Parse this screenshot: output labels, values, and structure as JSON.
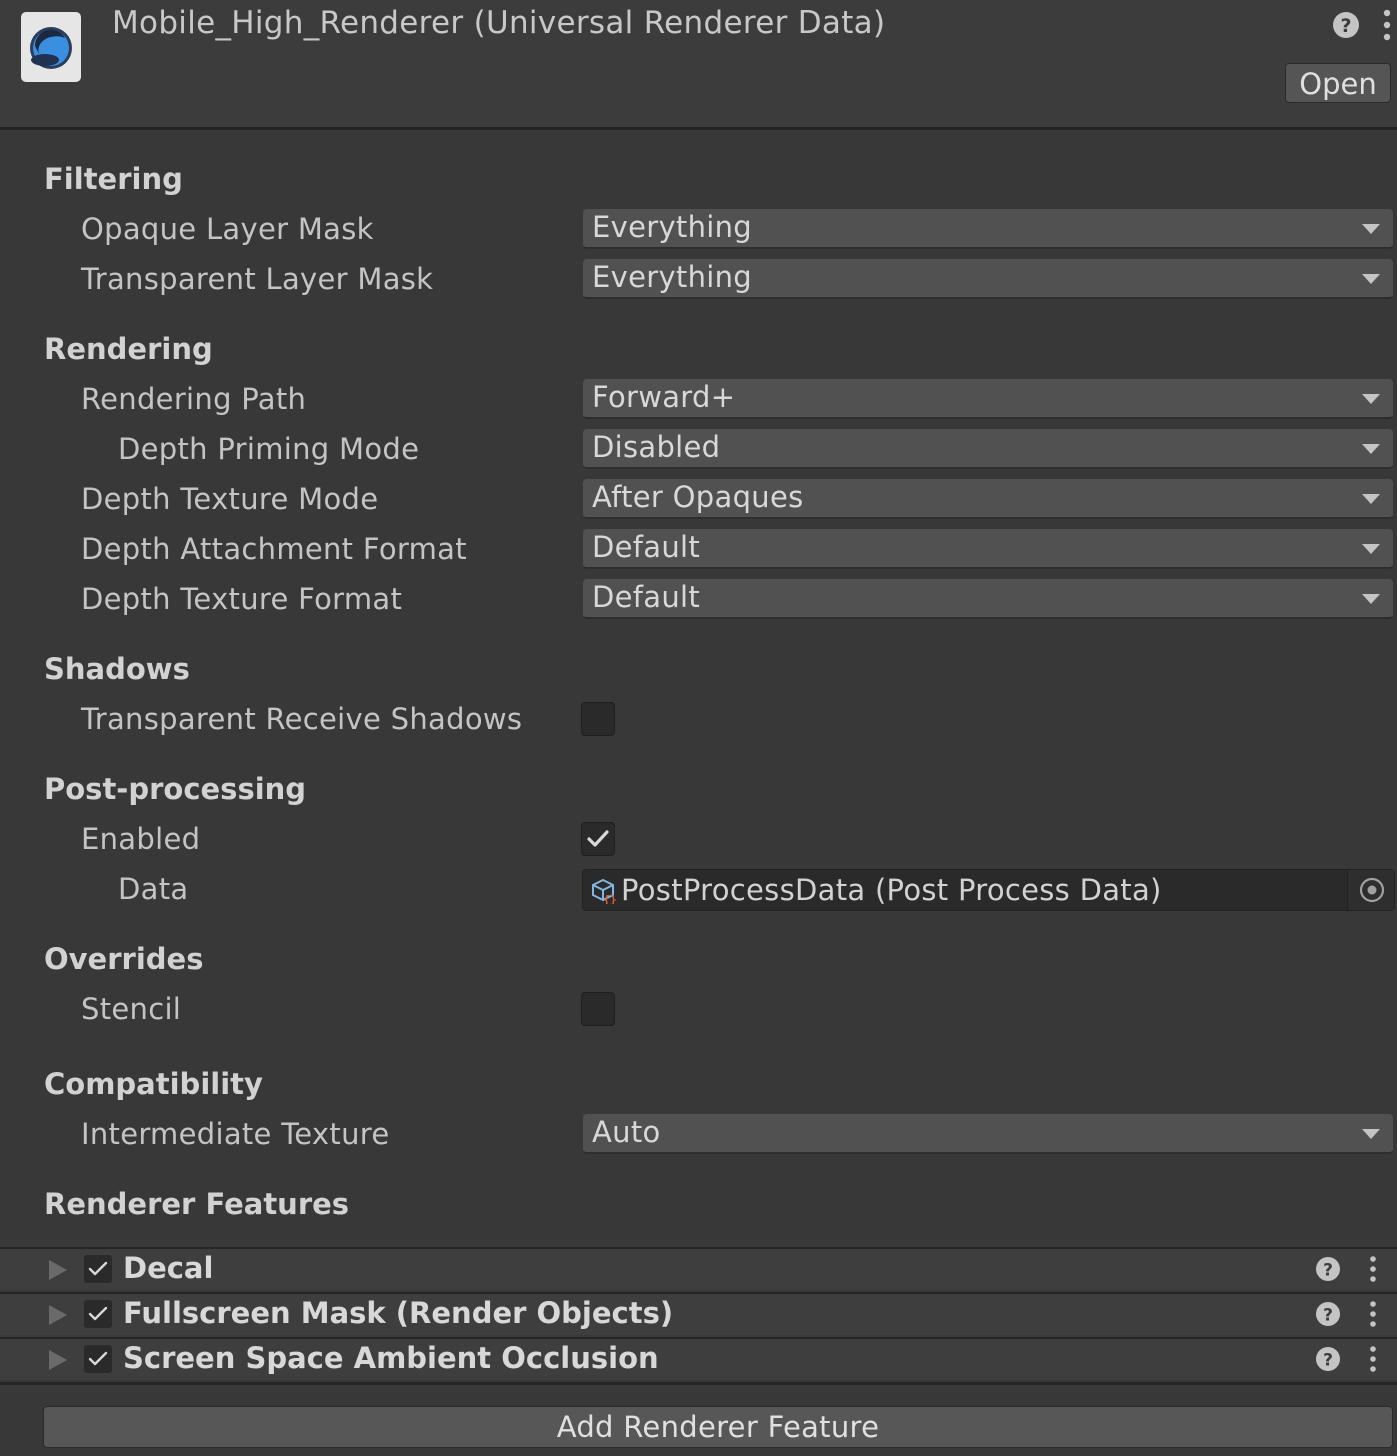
{
  "header": {
    "title": "Mobile_High_Renderer (Universal Renderer Data)",
    "asset_icon": "universal-renderer-data-icon",
    "help_icon": "help-icon",
    "menu_icon": "kebab-menu-icon",
    "open_label": "Open"
  },
  "filtering": {
    "title": "Filtering",
    "opaque_label": "Opaque Layer Mask",
    "opaque_value": "Everything",
    "transparent_label": "Transparent Layer Mask",
    "transparent_value": "Everything"
  },
  "rendering": {
    "title": "Rendering",
    "path_label": "Rendering Path",
    "path_value": "Forward+",
    "priming_label": "Depth Priming Mode",
    "priming_value": "Disabled",
    "depth_mode_label": "Depth Texture Mode",
    "depth_mode_value": "After Opaques",
    "attach_format_label": "Depth Attachment Format",
    "attach_format_value": "Default",
    "tex_format_label": "Depth Texture Format",
    "tex_format_value": "Default"
  },
  "shadows": {
    "title": "Shadows",
    "receive_label": "Transparent Receive Shadows",
    "receive_checked": false
  },
  "post_processing": {
    "title": "Post-processing",
    "enabled_label": "Enabled",
    "enabled_checked": true,
    "data_label": "Data",
    "data_value": "PostProcessData (Post Process Data)"
  },
  "overrides": {
    "title": "Overrides",
    "stencil_label": "Stencil",
    "stencil_checked": false
  },
  "compatibility": {
    "title": "Compatibility",
    "intermediate_label": "Intermediate Texture",
    "intermediate_value": "Auto"
  },
  "renderer_features": {
    "title": "Renderer Features",
    "items": [
      {
        "name": "Decal",
        "enabled": true
      },
      {
        "name": "Fullscreen Mask (Render Objects)",
        "enabled": true
      },
      {
        "name": "Screen Space Ambient Occlusion",
        "enabled": true
      }
    ],
    "add_label": "Add Renderer Feature"
  },
  "colors": {
    "background": "#383838",
    "header": "#3c3c3c",
    "field": "#515151",
    "text": "#c4c4c4"
  }
}
